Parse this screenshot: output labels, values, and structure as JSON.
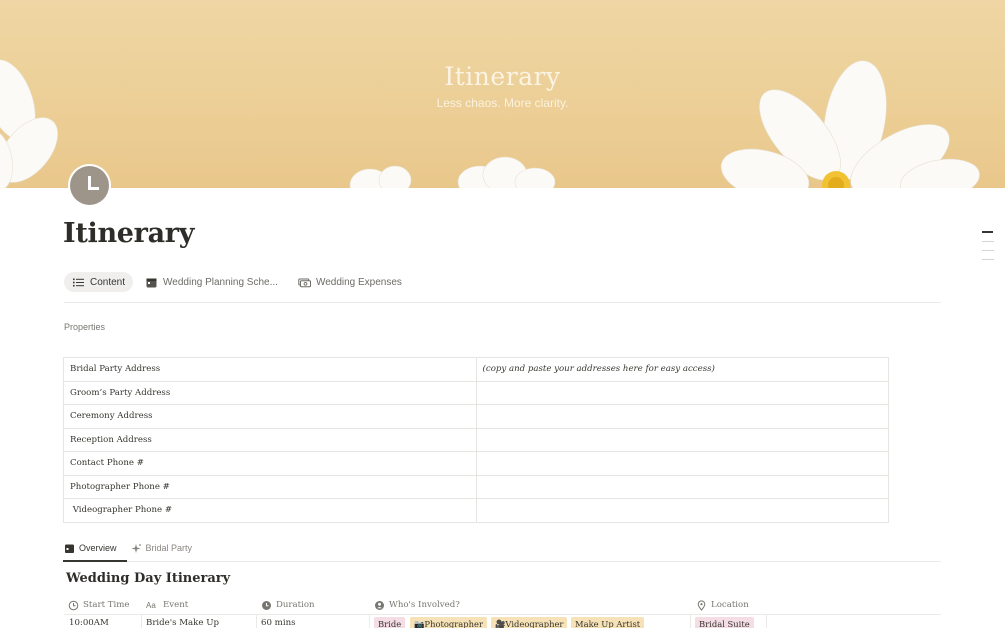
{
  "cover": {
    "title": "Itinerary",
    "subtitle": "Less chaos. More clarity."
  },
  "page": {
    "title": "Itinerary",
    "icon": "clock-icon"
  },
  "tabs": [
    {
      "label": "Content",
      "icon": "list-icon",
      "active": true
    },
    {
      "label": "Wedding Planning Sche...",
      "icon": "calendar-icon",
      "active": false
    },
    {
      "label": "Wedding Expenses",
      "icon": "money-icon",
      "active": false
    }
  ],
  "properties_label": "Properties",
  "addresses": {
    "rows": [
      {
        "label": "Bridal Party Address",
        "value": "(copy and paste your addresses here for easy access)"
      },
      {
        "label": "Groom’s Party Address",
        "value": ""
      },
      {
        "label": "Ceremony Address",
        "value": ""
      },
      {
        "label": "Reception Address",
        "value": ""
      },
      {
        "label": "Contact Phone #",
        "value": ""
      },
      {
        "label": "Photographer Phone #",
        "value": ""
      },
      {
        "label": " Videographer Phone #",
        "value": ""
      }
    ]
  },
  "views": [
    {
      "label": "Overview",
      "icon": "calendar-icon",
      "active": true
    },
    {
      "label": "Bridal Party",
      "icon": "sparkle-icon",
      "active": false
    }
  ],
  "section_title": "Wedding Day Itinerary",
  "itinerary": {
    "columns": [
      {
        "label": "Start Time",
        "icon": "clock-icon"
      },
      {
        "label": "Event",
        "icon": "text-icon"
      },
      {
        "label": "Duration",
        "icon": "timer-icon"
      },
      {
        "label": "Who's Involved?",
        "icon": "person-icon"
      },
      {
        "label": "Location",
        "icon": "pin-icon"
      }
    ],
    "rows": [
      {
        "start_time": "10:00AM",
        "event": "Bride's Make Up",
        "duration": "60 mins",
        "who": [
          {
            "label": "Bride",
            "color": "#f5dde6"
          },
          {
            "label": "📷Photographer",
            "color": "#f6e2b6"
          },
          {
            "label": "🎥Videographer",
            "color": "#f6e2b6"
          },
          {
            "label": "Make Up Artist",
            "color": "#f6e2b6"
          }
        ],
        "location": {
          "label": "Bridal Suite",
          "color": "#f5dde6"
        }
      }
    ]
  }
}
